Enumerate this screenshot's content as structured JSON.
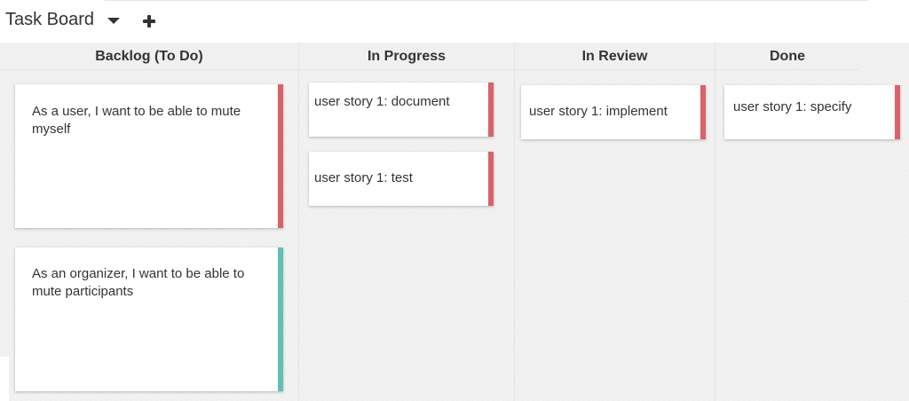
{
  "header": {
    "title": "Task Board",
    "dropdown_icon": "caret-down-icon",
    "add_icon": "plus-icon"
  },
  "colors": {
    "red": "#d9626a",
    "teal": "#5fc1b2"
  },
  "columns": [
    {
      "title": "Backlog (To Do)",
      "cards": [
        {
          "text": "As a user, I want to be able to mute myself",
          "color": "#d9626a"
        },
        {
          "text": "As an organizer, I want to be able to mute participants",
          "color": "#5fc1b2"
        }
      ]
    },
    {
      "title": "In Progress",
      "cards": [
        {
          "text": "user story 1: document",
          "color": "#d9626a"
        },
        {
          "text": "user story 1: test",
          "color": "#d9626a"
        }
      ]
    },
    {
      "title": "In Review",
      "cards": [
        {
          "text": "user story 1: implement",
          "color": "#d9626a"
        }
      ]
    },
    {
      "title": "Done",
      "cards": [
        {
          "text": "user story 1: specify",
          "color": "#d9626a"
        }
      ]
    }
  ]
}
